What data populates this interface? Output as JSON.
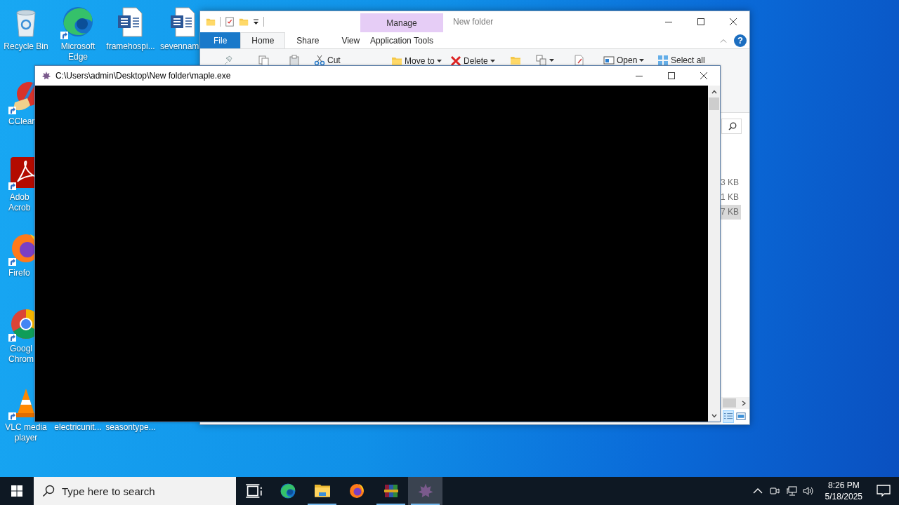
{
  "desktop_icons": [
    {
      "kind": "recycle-bin",
      "lines": [
        "Recycle Bin"
      ],
      "shortcut": false
    },
    {
      "kind": "edge",
      "lines": [
        "Microsoft",
        "Edge"
      ],
      "shortcut": true
    },
    {
      "kind": "word",
      "lines": [
        "framehospi..."
      ],
      "shortcut": false
    },
    {
      "kind": "word",
      "lines": [
        "sevennam"
      ],
      "shortcut": false
    },
    {
      "kind": "ccleaner",
      "lines": [
        "CClear"
      ],
      "shortcut": true
    },
    {
      "kind": "acrobat",
      "lines": [
        "Adob",
        "Acrob"
      ],
      "shortcut": true
    },
    {
      "kind": "firefox",
      "lines": [
        "Firefo"
      ],
      "shortcut": true
    },
    {
      "kind": "chrome",
      "lines": [
        "Googl",
        "Chrom"
      ],
      "shortcut": true
    },
    {
      "kind": "vlc",
      "lines": [
        "VLC media",
        "player"
      ],
      "shortcut": true
    },
    {
      "kind": "covered",
      "lines": [
        "electricunit..."
      ],
      "shortcut": false
    },
    {
      "kind": "covered",
      "lines": [
        "seasontype..."
      ],
      "shortcut": false
    }
  ],
  "explorer": {
    "title": "New folder",
    "context_header": "Manage",
    "help": "?",
    "tabs": [
      {
        "label": "File",
        "kind": "file",
        "selected": false
      },
      {
        "label": "Home",
        "kind": "normal",
        "selected": true
      },
      {
        "label": "Share",
        "kind": "normal",
        "selected": false
      },
      {
        "label": "View",
        "kind": "normal",
        "selected": false
      },
      {
        "label": "Application Tools",
        "kind": "context",
        "selected": false
      }
    ],
    "ribbon": [
      {
        "kind": "pin"
      },
      {
        "kind": "copy"
      },
      {
        "kind": "paste"
      },
      {
        "kind": "cut",
        "label": "Cut"
      },
      {
        "kind": "move",
        "label": "Move to",
        "dropdown": true
      },
      {
        "kind": "delete",
        "label": "Delete",
        "dropdown": true
      },
      {
        "kind": "new-folder"
      },
      {
        "kind": "copy-to",
        "dropdown": true
      },
      {
        "kind": "properties"
      },
      {
        "kind": "open",
        "label": "Open",
        "dropdown": true
      },
      {
        "kind": "select-all",
        "label": "Select all"
      }
    ],
    "sizes": [
      {
        "text": "3 KB",
        "selected": false
      },
      {
        "text": "1 KB",
        "selected": false
      },
      {
        "text": "7 KB",
        "selected": true
      }
    ],
    "views": [
      {
        "kind": "details",
        "selected": true
      },
      {
        "kind": "large-icons",
        "selected": false
      }
    ]
  },
  "console": {
    "title": "C:\\Users\\admin\\Desktop\\New folder\\maple.exe"
  },
  "taskbar": {
    "search": {
      "placeholder": "Type here to search"
    },
    "apps": [
      {
        "kind": "task-view",
        "running": false,
        "selected": false
      },
      {
        "kind": "edge",
        "running": false,
        "selected": false
      },
      {
        "kind": "explorer",
        "running": true,
        "selected": false
      },
      {
        "kind": "firefox",
        "running": false,
        "selected": false
      },
      {
        "kind": "winrar",
        "running": true,
        "selected": false
      },
      {
        "kind": "maple",
        "running": true,
        "selected": true
      }
    ],
    "time": "8:26 PM",
    "date": "5/18/2025"
  }
}
